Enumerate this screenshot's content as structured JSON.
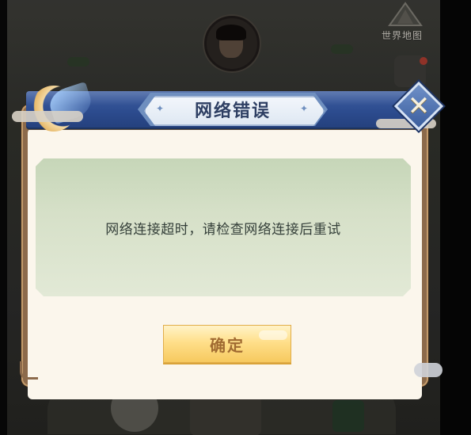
{
  "background": {
    "world_map_label": "世界地图"
  },
  "dialog": {
    "title": "网络错误",
    "message": "网络连接超时，请检查网络连接后重试",
    "confirm_label": "确定",
    "close_symbol": "✕"
  },
  "colors": {
    "title_bar": "#2c4b8e",
    "panel_bg": "#fbf6ec",
    "message_panel": "#d6e0c8",
    "confirm_button": "#ffdf8a",
    "confirm_text": "#a06a31"
  },
  "icons": {
    "close": "close-x-icon",
    "moon": "crescent-moon-icon",
    "sparkle": "sparkle-icon"
  }
}
